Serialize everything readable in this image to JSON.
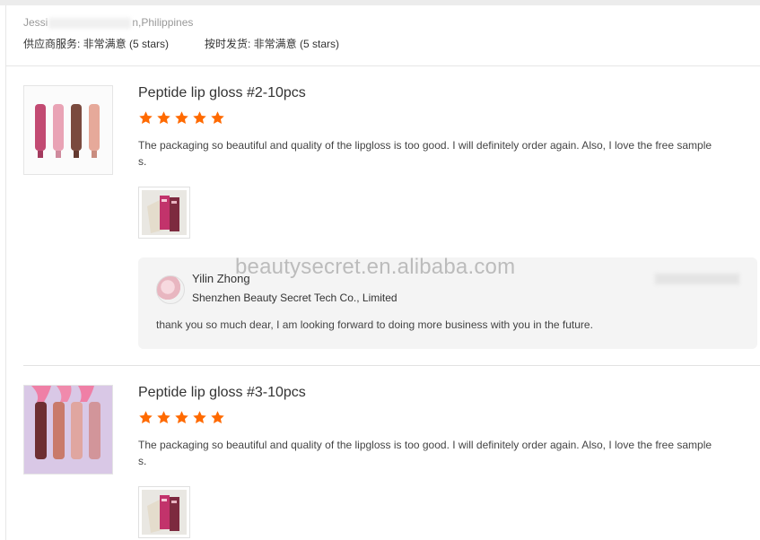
{
  "header": {
    "reviewer_start": "Jessi",
    "reviewer_end": "n,Philippines",
    "supplier_service": "供应商服务: 非常满意 (5 stars)",
    "on_time_shipping": "按时发货: 非常满意 (5 stars)"
  },
  "reviews": [
    {
      "title": "Peptide lip gloss #2-10pcs",
      "rating": 5,
      "comment": "The packaging so beautiful and quality of the lipgloss is too good. I will definitely order again. Also, I love the free sample s.",
      "reply": {
        "name": "Yilin Zhong",
        "company": "Shenzhen Beauty Secret Tech Co., Limited",
        "text": "thank you so much dear, I am looking forward to doing more business with you in the future."
      }
    },
    {
      "title": "Peptide lip gloss #3-10pcs",
      "rating": 5,
      "comment": "The packaging so beautiful and quality of the lipgloss is too good. I will definitely order again. Also, I love the free sample s."
    }
  ],
  "watermark": "beautysecret.en.alibaba.com",
  "colors": {
    "star": "#ff6a00",
    "reply_bg": "#f4f4f4"
  }
}
